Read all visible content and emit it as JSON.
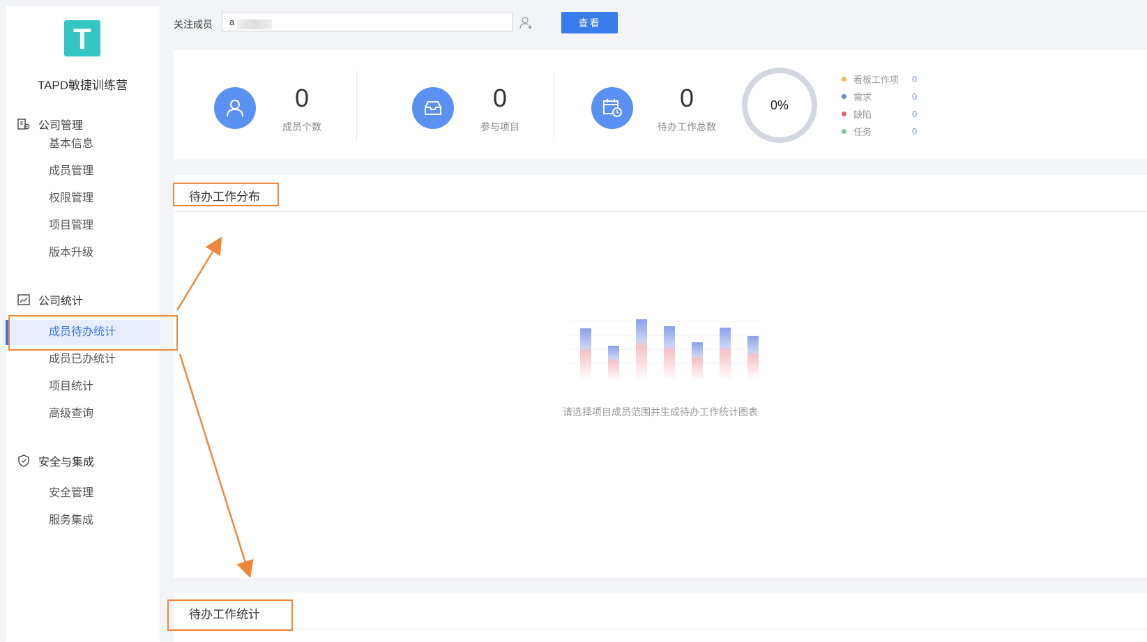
{
  "sidebar": {
    "org_name": "TAPD敏捷训练营",
    "logo_letter": "T",
    "logo_color": "#34c6c0",
    "groups": [
      {
        "label": "公司管理",
        "icon": "company-icon",
        "items": [
          "基本信息",
          "成员管理",
          "权限管理",
          "项目管理",
          "版本升级"
        ]
      },
      {
        "label": "公司统计",
        "icon": "chart-icon",
        "items": [
          "成员待办统计",
          "成员已办统计",
          "项目统计",
          "高级查询"
        ]
      },
      {
        "label": "安全与集成",
        "icon": "shield-icon",
        "items": [
          "安全管理",
          "服务集成"
        ]
      }
    ],
    "active_item": "成员待办统计"
  },
  "topbar": {
    "follow_label": "关注成员",
    "follow_value": "a",
    "view_button": "查看"
  },
  "stats": {
    "members": {
      "value": "0",
      "label": "成员个数",
      "icon": "user-icon"
    },
    "projects": {
      "value": "0",
      "label": "参与项目",
      "icon": "inbox-icon"
    },
    "todos": {
      "value": "0",
      "label": "待办工作总数",
      "icon": "calendar-clock-icon"
    },
    "donut": {
      "percent": "0%"
    },
    "legend": [
      {
        "name": "看板工作项",
        "value": "0",
        "color": "#f5b945"
      },
      {
        "name": "需求",
        "value": "0",
        "color": "#6c84d8"
      },
      {
        "name": "缺陷",
        "value": "0",
        "color": "#e8626f"
      },
      {
        "name": "任务",
        "value": "0",
        "color": "#7fcaa0"
      }
    ]
  },
  "distribution_panel": {
    "title": "待办工作分布",
    "empty_message": "请选择项目成员范围并生成待办工作统计图表"
  },
  "statistics_panel": {
    "title": "待办工作统计"
  },
  "accent_color": "#3a74ea",
  "annotation_color": "#f0883a"
}
